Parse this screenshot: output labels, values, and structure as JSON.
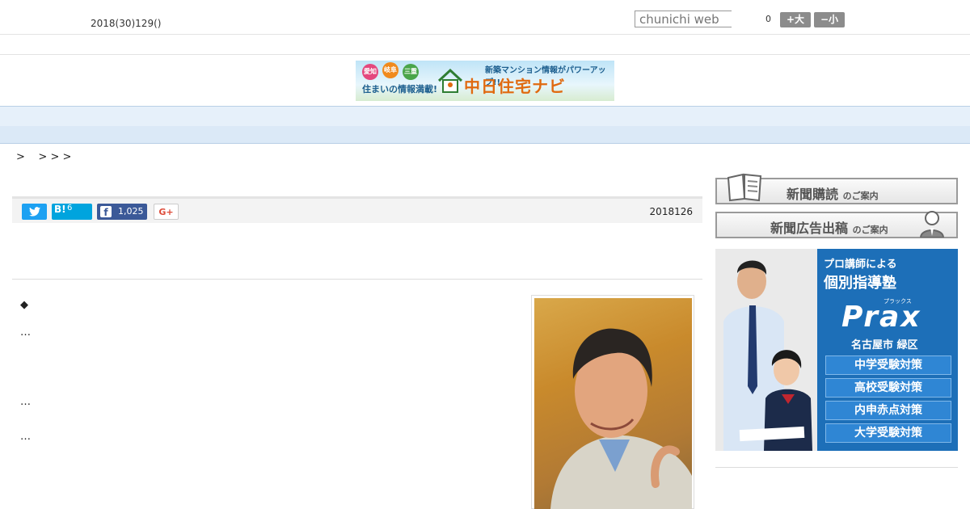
{
  "header": {
    "date": "2018(30)129()",
    "search_placeholder": "chunichi web",
    "counter": "0",
    "font_larger_label": "+大",
    "font_smaller_label": "−小"
  },
  "banner": {
    "bubble1": "愛知",
    "bubble2": "岐阜",
    "bubble3": "三重",
    "tagline": "住まいの情報満載!",
    "promo": "新築マンション情報がパワーアップ!!",
    "name": "中日住宅ナビ"
  },
  "nav": {
    "items": [
      "",
      "",
      "",
      "",
      "",
      "",
      "",
      "",
      ""
    ]
  },
  "breadcrumb": ">    > > >",
  "share": {
    "twitter_icon": "twitter-icon",
    "hatena_label": "B!",
    "hatena_count": "6",
    "facebook_count": "1,025",
    "gplus_label": "G+",
    "publish_date": "2018126"
  },
  "article": {
    "lines": [
      "◆",
      "…",
      "…",
      "…"
    ]
  },
  "sidebar": {
    "subscribe_main": "新聞購読",
    "subscribe_small": "のご案内",
    "ad_main": "新聞広告出稿",
    "ad_small": "のご案内",
    "prax": {
      "line1": "プロ講師による",
      "line2": "個別指導塾",
      "ruby": "プラックス",
      "brand": "Prax",
      "location": "名古屋市 緑区",
      "pills": [
        "中学受験対策",
        "高校受験対策",
        "内申赤点対策",
        "大学受験対策"
      ]
    }
  }
}
